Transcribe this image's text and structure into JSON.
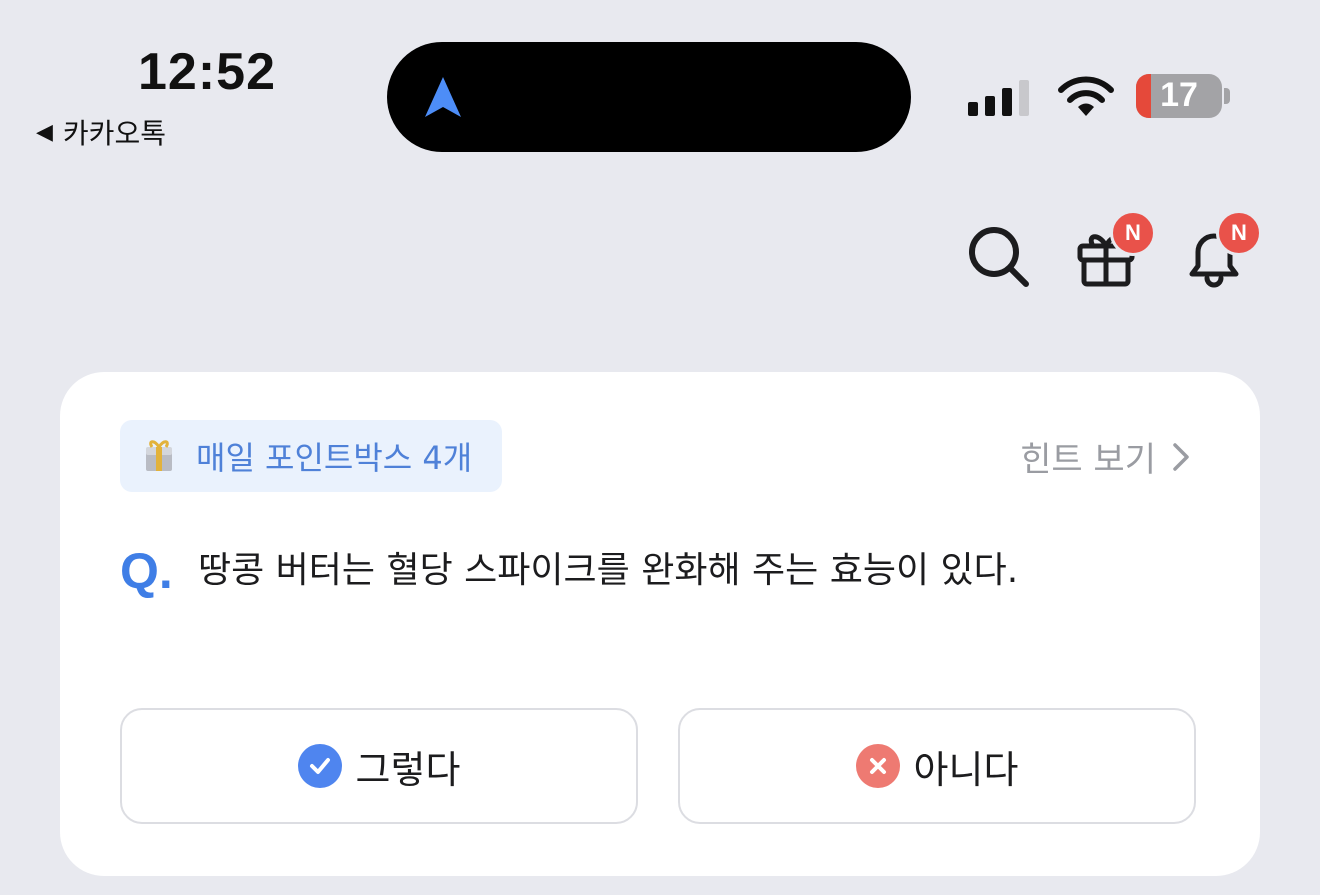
{
  "status_bar": {
    "time": "12:52",
    "back_app": "카카오톡",
    "battery_level": "17"
  },
  "header": {
    "badges": {
      "gift": "N",
      "bell": "N"
    }
  },
  "card": {
    "points_label": "매일 포인트박스 4개",
    "hint_label": "힌트 보기",
    "q_mark": "Q.",
    "question": "땅콩 버터는 혈당 스파이크를 완화해 주는 효능이 있다.",
    "yes_label": "그렇다",
    "no_label": "아니다"
  },
  "colors": {
    "accent_blue": "#3f7ee6",
    "badge_red": "#e9524a",
    "no_red": "#ee7a72"
  }
}
